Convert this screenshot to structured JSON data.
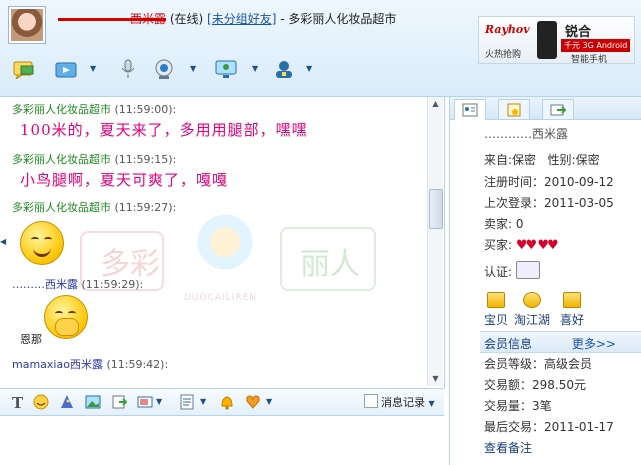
{
  "header": {
    "contact_name_redacted": "——————西米露",
    "status": "(在线)",
    "group": "[未分组好友]",
    "separator": " - ",
    "shop_name": "多彩丽人化妆品超市"
  },
  "ad": {
    "brand": "Rayhov",
    "left_text": "火热抢购",
    "product": "锐合",
    "tag": "千元 3G Android",
    "sub": "智能手机"
  },
  "chat": {
    "messages": [
      {
        "sender": "多彩丽人化妆品超市",
        "time": "(11:59:00):",
        "text": "100米的，夏天来了，多用用腿部，嘿嘿"
      },
      {
        "sender": "多彩丽人化妆品超市",
        "time": "(11:59:15):",
        "text": "小鸟腿啊，夏天可爽了，嘎嘎"
      },
      {
        "sender": "多彩丽人化妆品超市",
        "time": "(11:59:27):",
        "text": ""
      },
      {
        "sender": "………西米露",
        "time": "(11:59:29):",
        "text": "恩那"
      },
      {
        "sender": "mamaxiao西米露",
        "time": "(11:59:42):",
        "text": ""
      }
    ],
    "watermark_left": "多彩",
    "watermark_right": "丽人",
    "watermark_sub": "DUOCAILIREN"
  },
  "input_bar": {
    "history_label": "消息记录"
  },
  "profile": {
    "name": "…………西米露",
    "from_label": "来自:",
    "from_value": "保密",
    "gender_label": "性别:",
    "gender_value": "保密",
    "reg_label": "注册时间：",
    "reg_value": "2010-09-12",
    "last_label": "上次登录：",
    "last_value": "2011-03-05",
    "seller_label": "卖家:",
    "seller_value": "0",
    "buyer_label": "买家:",
    "cert_label": "认证:",
    "services": [
      "宝贝",
      "淘江湖",
      "喜好"
    ],
    "member_title": "会员信息",
    "member_more": "更多>>",
    "level_label": "会员等级：",
    "level_value": "高级会员",
    "amount_label": "交易额：",
    "amount_value": "298.50元",
    "count_label": "交易量：",
    "count_value": "3笔",
    "recent_label": "最后交易：",
    "recent_value": "2011-01-17",
    "notes_link": "查看备注"
  }
}
